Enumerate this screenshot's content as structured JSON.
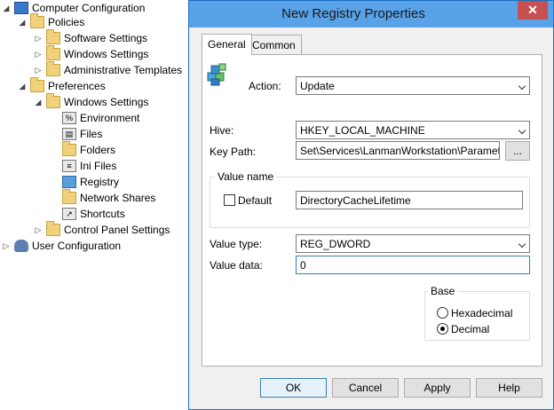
{
  "tree": {
    "computer_configuration": "Computer Configuration",
    "policies": "Policies",
    "software_settings": "Software Settings",
    "windows_settings": "Windows Settings",
    "administrative_templates": "Administrative Templates",
    "preferences": "Preferences",
    "pref_windows_settings": "Windows Settings",
    "environment": "Environment",
    "files": "Files",
    "folders": "Folders",
    "ini_files": "Ini Files",
    "registry": "Registry",
    "network_shares": "Network Shares",
    "shortcuts": "Shortcuts",
    "control_panel_settings": "Control Panel Settings",
    "user_configuration": "User Configuration"
  },
  "dialog": {
    "title": "New Registry Properties",
    "close": "✕",
    "tabs": {
      "general": "General",
      "common": "Common"
    },
    "action_label": "Action:",
    "action_value": "Update",
    "hive_label": "Hive:",
    "hive_value": "HKEY_LOCAL_MACHINE",
    "keypath_label": "Key Path:",
    "keypath_value": "Set\\Services\\LanmanWorkstation\\Parameters",
    "browse_label": "...",
    "value_name_group": "Value name",
    "default_label": "Default",
    "value_name": "DirectoryCacheLifetime",
    "value_type_label": "Value type:",
    "value_type": "REG_DWORD",
    "value_data_label": "Value data:",
    "value_data": "0",
    "base_group": "Base",
    "hex_label": "Hexadecimal",
    "dec_label": "Decimal",
    "buttons": {
      "ok": "OK",
      "cancel": "Cancel",
      "apply": "Apply",
      "help": "Help"
    }
  }
}
